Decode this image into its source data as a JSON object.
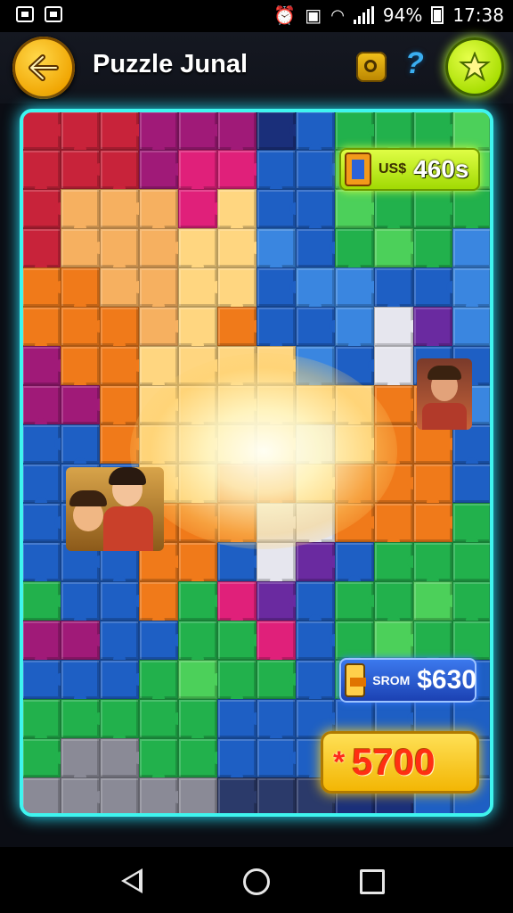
{
  "status_bar": {
    "battery": "94%",
    "time": "17:38",
    "left_icons": [
      "notification-icon",
      "gallery-icon"
    ],
    "right_icons": [
      "alarm-icon",
      "camera-icon",
      "wifi-icon",
      "signal-icon",
      "battery-icon"
    ]
  },
  "header": {
    "title": "Puzzle Junal",
    "back_icon": "arrow-left-icon",
    "coin_icon": "coin-icon",
    "help_label": "?",
    "star_icon": "star-icon"
  },
  "badges": {
    "top": {
      "prefix": "US$",
      "value": "460s"
    },
    "middle": {
      "prefix": "SROM",
      "value": "$630"
    },
    "score": {
      "value": "5700"
    }
  },
  "colors": {
    "accent": "#3ff5ef",
    "score_badge": "#f2b400",
    "score_text": "#ff2f12",
    "back_button": "#f0a400",
    "star_button": "#a6dd00"
  },
  "nav_bar": {
    "icons": [
      "back-triangle-icon",
      "home-circle-icon",
      "recent-square-icon"
    ]
  }
}
